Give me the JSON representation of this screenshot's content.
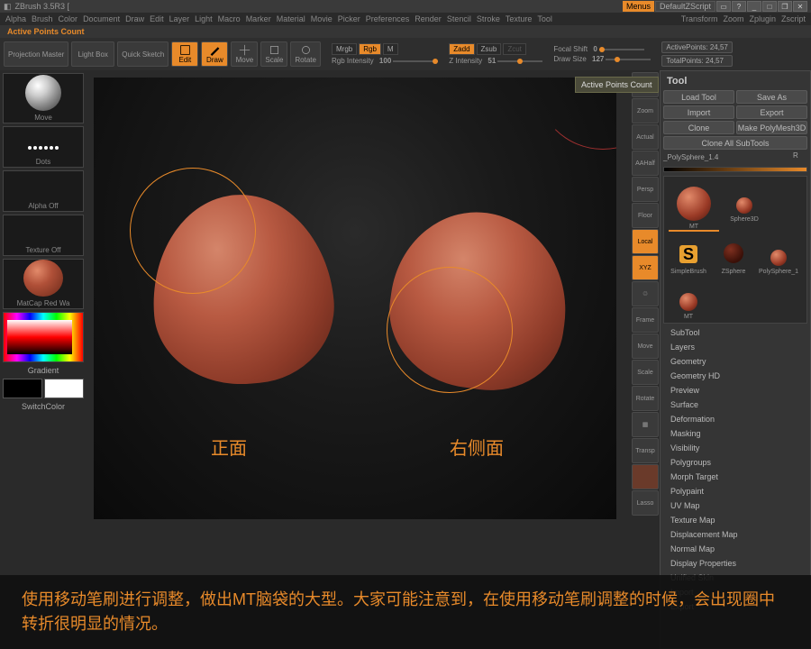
{
  "app": {
    "title": "ZBrush 3.5R3 ["
  },
  "titlebar": {
    "menus": "Menus",
    "default": "DefaultZScript"
  },
  "menu": {
    "items": [
      "Alpha",
      "Brush",
      "Color",
      "Document",
      "Draw",
      "Edit",
      "Layer",
      "Light",
      "Macro",
      "Marker",
      "Material",
      "Movie",
      "Picker",
      "Preferences",
      "Render",
      "Stencil",
      "Stroke",
      "Texture",
      "Tool",
      "Transform",
      "Zoom",
      "Zplugin",
      "Zscript"
    ]
  },
  "status": {
    "text": "Active Points Count"
  },
  "toolbar": {
    "proj": "Projection Master",
    "lightbox": "Light Box",
    "quick": "Quick Sketch",
    "edit": "Edit",
    "draw": "Draw",
    "move": "Move",
    "scale": "Scale",
    "rotate": "Rotate",
    "mrgb": "Mrgb",
    "rgb": "Rgb",
    "m": "M",
    "rgbint_label": "Rgb Intensity",
    "rgbint_val": "100",
    "zadd": "Zadd",
    "zsub": "Zsub",
    "zcut": "Zcut",
    "zint_label": "Z Intensity",
    "zint_val": "51",
    "focal_label": "Focal Shift",
    "focal_val": "0",
    "drawsize_label": "Draw Size",
    "drawsize_val": "127",
    "active_label": "ActivePoints:",
    "active_val": "24,57",
    "total_label": "TotalPoints:",
    "total_val": "24,57"
  },
  "left": {
    "move": "Move",
    "dots": "Dots",
    "alphaoff": "Alpha Off",
    "texoff": "Texture Off",
    "matcap": "MatCap Red Wa",
    "gradient": "Gradient",
    "switch": "SwitchColor"
  },
  "viewport": {
    "front": "正面",
    "side": "右侧面"
  },
  "caption": {
    "text": "使用移动笔刷进行调整，做出MT脑袋的大型。大家可能注意到，在使用移动笔刷调整的时候，会出现圈中转折很明显的情况。"
  },
  "icons": {
    "items": [
      "Scrol",
      "Zoom",
      "Actual",
      "AAHalf",
      "Persp",
      "Floor",
      "Local",
      "XYZ",
      "",
      "Frame",
      "Move",
      "Scale",
      "Rotate",
      "",
      "Transp",
      "",
      "Lasso"
    ]
  },
  "rpanel": {
    "title": "Tool",
    "buttons": [
      "Load Tool",
      "Save As",
      "Import",
      "Export",
      "Clone",
      "Make PolyMesh3D",
      "Clone All SubTools"
    ],
    "r_label": "R",
    "poly": "_PolySphere_1.4",
    "tools": {
      "mt": "MT",
      "sphere": "Sphere3D",
      "simple": "SimpleBrush",
      "zsphere": "ZSphere",
      "poly1": "PolySphere_1",
      "mt2": "MT"
    },
    "sections": [
      "SubTool",
      "Layers",
      "Geometry",
      "Geometry HD",
      "Preview",
      "Surface",
      "Deformation",
      "Masking",
      "Visibility",
      "Polygroups",
      "Morph Target",
      "Polypaint",
      "UV Map",
      "Texture Map",
      "Displacement Map",
      "Normal Map",
      "Display Properties",
      "Unified Skin",
      "Import",
      "Export"
    ]
  },
  "tooltip": {
    "text": "Active Points Count"
  }
}
